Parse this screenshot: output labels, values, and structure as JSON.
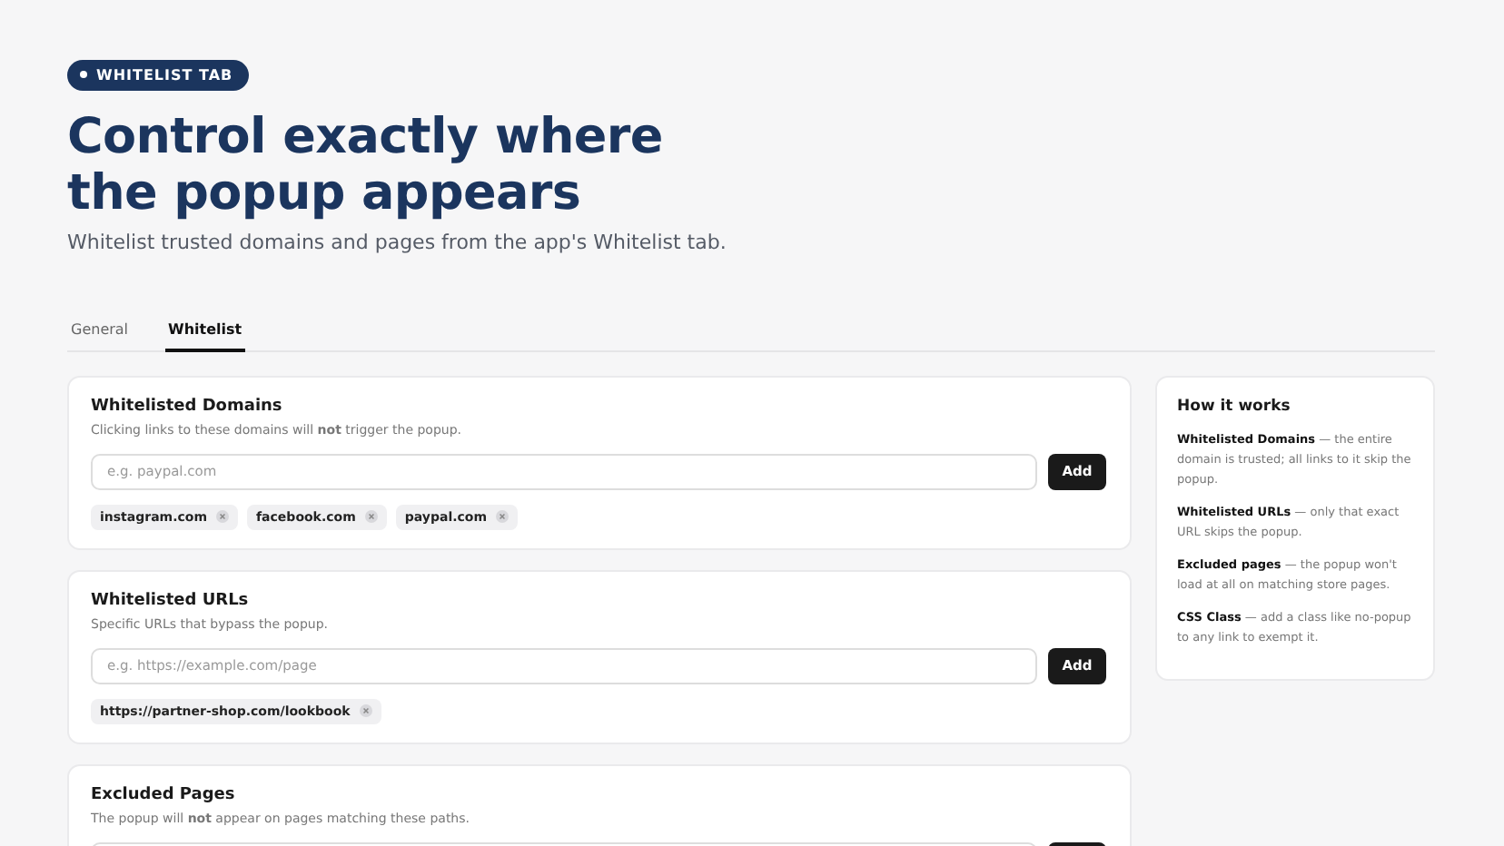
{
  "badge": "WHITELIST TAB",
  "title": "Control exactly where the popup appears",
  "subtitle": "Whitelist trusted domains and pages from the app's Whitelist tab.",
  "tabs": [
    {
      "label": "General",
      "selected": false
    },
    {
      "label": "Whitelist",
      "selected": true
    }
  ],
  "cards": [
    {
      "title": "Whitelisted Domains",
      "description": "Clicking links to these domains will **not** trigger the popup.",
      "placeholder": "e.g. paypal.com",
      "button": "Add",
      "chips": [
        "instagram.com",
        "facebook.com",
        "paypal.com"
      ]
    },
    {
      "title": "Whitelisted URLs",
      "description": "Specific URLs that bypass the popup.",
      "placeholder": "e.g. https://example.com/page",
      "button": "Add",
      "chips": [
        "https://partner-shop.com/lookbook"
      ]
    },
    {
      "title": "Excluded Pages",
      "description": "The popup will **not** appear on pages matching these paths."
    }
  ],
  "help": {
    "title": "How it works",
    "items": [
      "**Whitelisted Domains** — the entire domain is trusted; all links to it skip the popup.",
      "**Whitelisted URLs** — only that exact URL skips the popup.",
      "**Excluded pages** — the popup won't load at all on matching store pages.",
      "**CSS Class** — add a class like no-popup to any link to exempt it."
    ]
  }
}
